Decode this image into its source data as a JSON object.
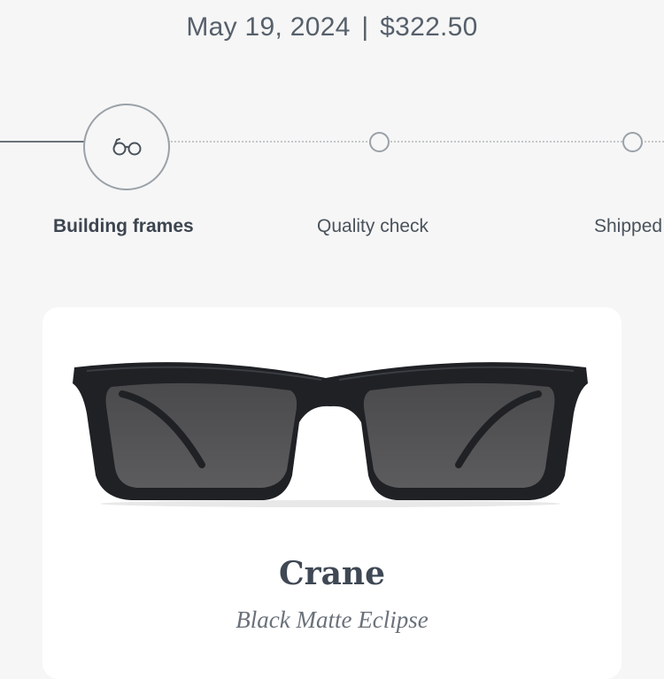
{
  "order": {
    "date": "May 19, 2024",
    "separator": "|",
    "total": "$322.50"
  },
  "tracker": {
    "current_step_icon": "glasses-icon",
    "steps": [
      {
        "label": "Building frames",
        "state": "active"
      },
      {
        "label": "Quality check",
        "state": "pending"
      },
      {
        "label": "Shipped",
        "state": "pending"
      }
    ]
  },
  "product": {
    "image_icon": "eyeglasses-product-image",
    "name": "Crane",
    "variant": "Black Matte Eclipse"
  },
  "colors": {
    "background": "#f6f6f6",
    "card": "#ffffff",
    "text_dark": "#3d4550",
    "tracker_line": "#9aa1a8"
  }
}
